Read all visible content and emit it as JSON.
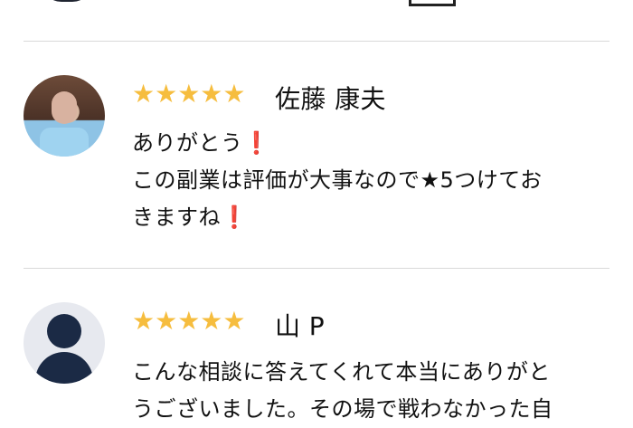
{
  "review1": {
    "name": "佐藤 康夫",
    "lines": [
      "ありがとう",
      "この副業は評価が大事なので★5つけてお",
      "きますね"
    ],
    "exclaim": "❗"
  },
  "review2": {
    "name": "山 P",
    "lines": [
      "こんな相談に答えてくれて本当にありがと",
      "うございました。その場で戦わなかった自"
    ]
  },
  "stars": {
    "icon": "★★★★★",
    "rating": 5,
    "color": "#f6bd3e"
  }
}
